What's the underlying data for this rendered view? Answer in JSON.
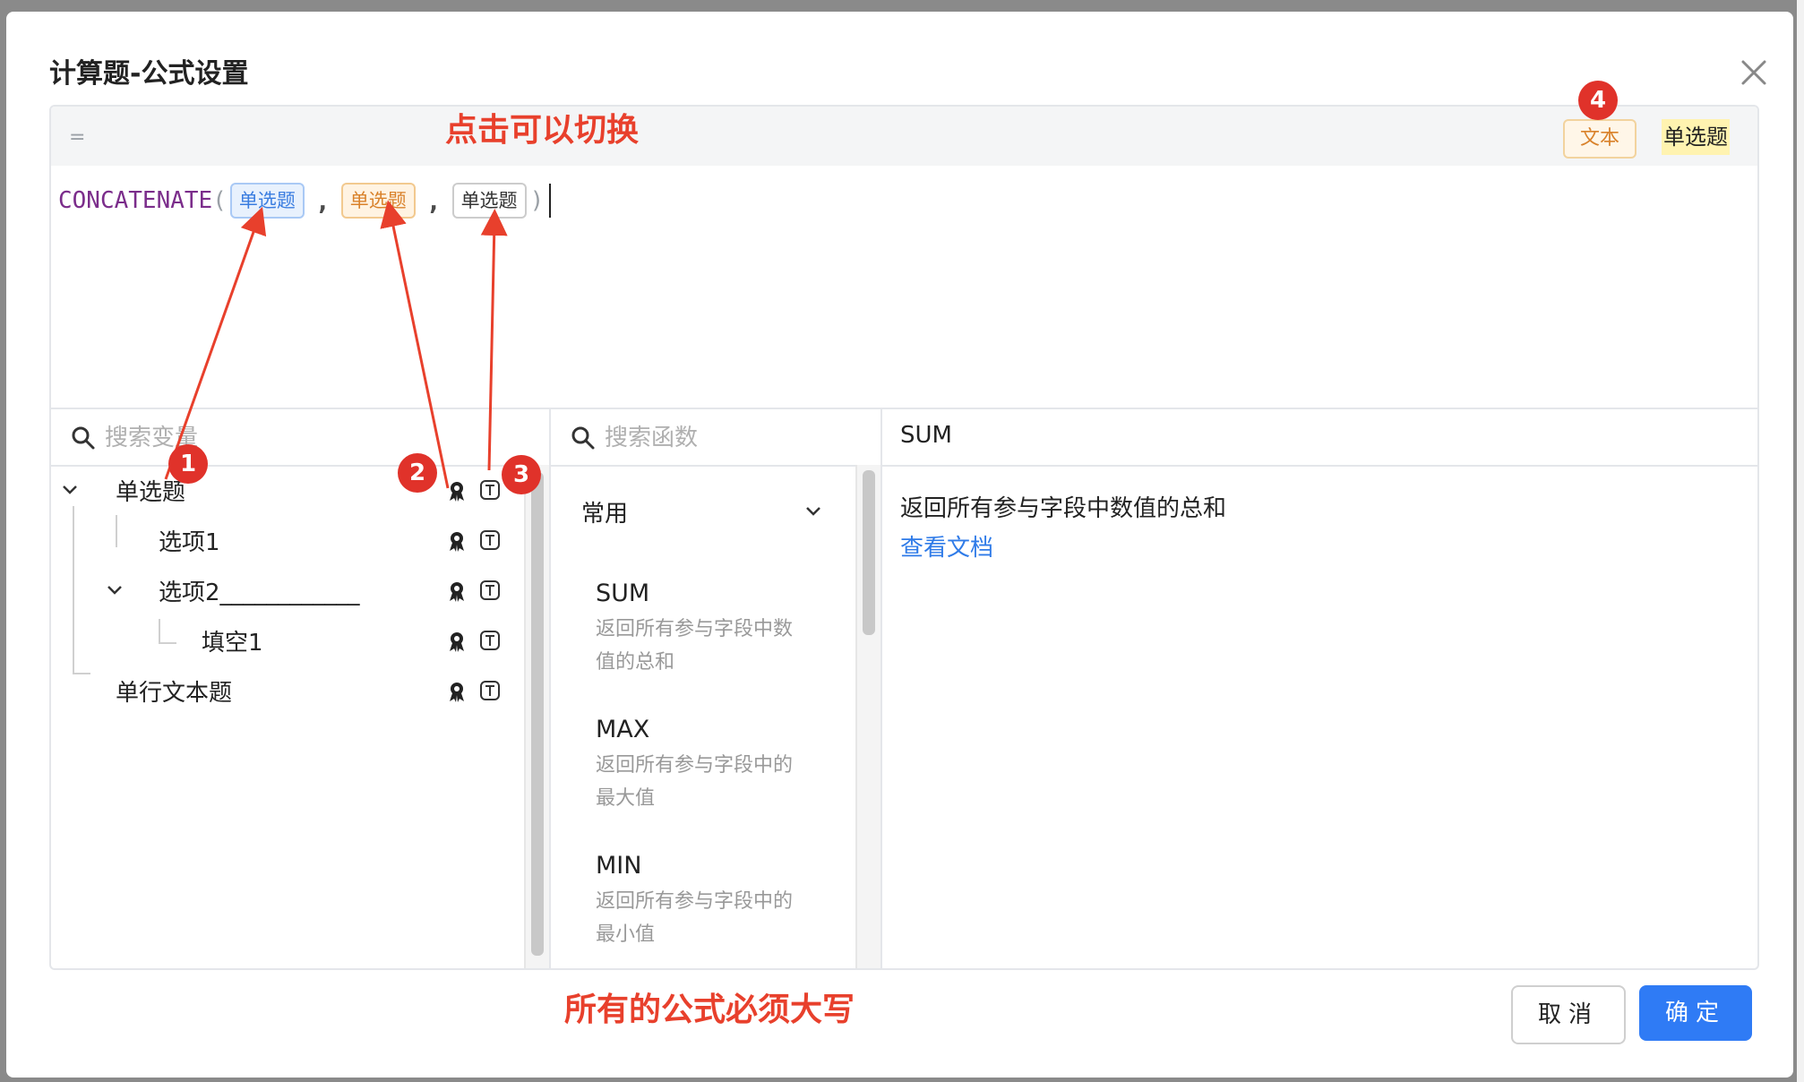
{
  "dialog": {
    "title": "计算题-公式设置",
    "toolbar": {
      "eq_symbol": "=",
      "type_toggle": "文本",
      "current_label": "单选题"
    },
    "formula": {
      "function": "CONCATENATE",
      "open_paren": "(",
      "close_paren": ")",
      "comma": ",",
      "chips": [
        "单选题",
        "单选题",
        "单选题"
      ]
    },
    "variables": {
      "search_placeholder": "搜索变量",
      "items": [
        {
          "label": "单选题"
        },
        {
          "label": "选项1"
        },
        {
          "label": "选项2____________"
        },
        {
          "label": "填空1"
        },
        {
          "label": "单行文本题"
        }
      ]
    },
    "functions": {
      "search_placeholder": "搜索函数",
      "group": "常用",
      "items": [
        {
          "name": "SUM",
          "desc_line1": "返回所有参与字段中数",
          "desc_line2": "值的总和"
        },
        {
          "name": "MAX",
          "desc_line1": "返回所有参与字段中的",
          "desc_line2": "最大值"
        },
        {
          "name": "MIN",
          "desc_line1": "返回所有参与字段中的",
          "desc_line2": "最小值"
        }
      ]
    },
    "doc": {
      "title": "SUM",
      "description": "返回所有参与字段中数值的总和",
      "link": "查看文档"
    },
    "buttons": {
      "cancel": "取消",
      "ok": "确定"
    }
  },
  "annotations": {
    "toggle_note": "点击可以切换",
    "uppercase_note": "所有的公式必须大写",
    "badges": [
      "1",
      "2",
      "3",
      "4"
    ]
  },
  "colors": {
    "primary": "#2f7bf5",
    "annotation_red": "#e8402c",
    "function_purple": "#7b2d8b",
    "chip_blue": "#3a7de0",
    "chip_orange": "#d9822b"
  }
}
